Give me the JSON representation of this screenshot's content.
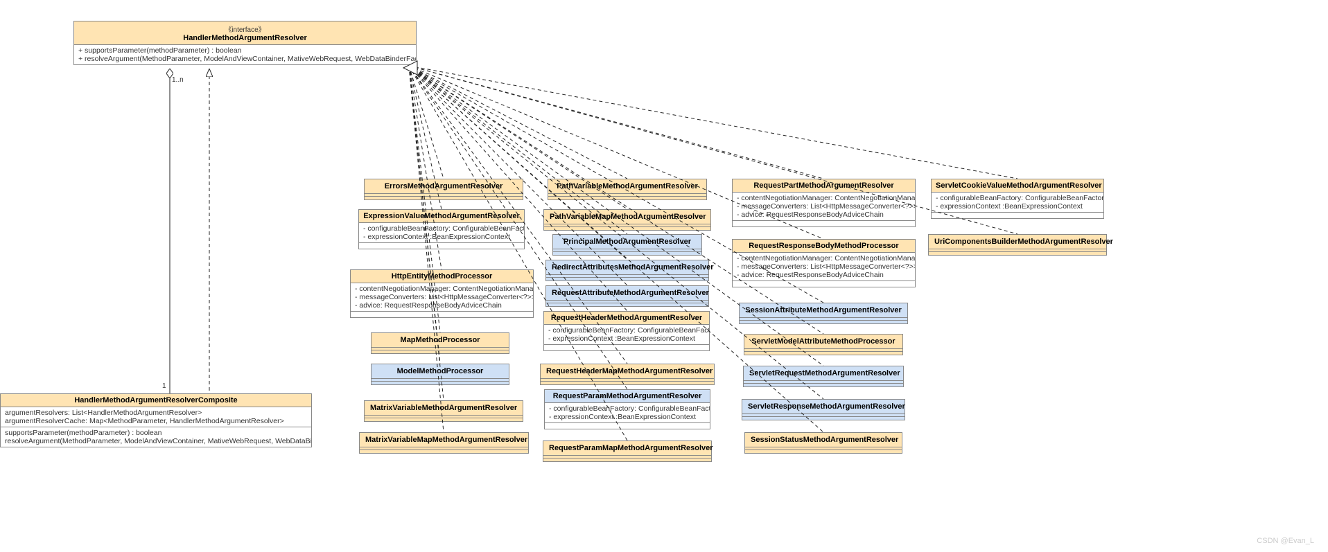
{
  "interface": {
    "stereotype": "《interface》",
    "name": "HandlerMethodArgumentResolver",
    "op1": "+ supportsParameter(methodParameter) : boolean",
    "op2": "+ resolveArgument(MethodParameter, ModelAndViewContainer, MativeWebRequest, WebDataBinderFactory): Object"
  },
  "composite": {
    "name": "HandlerMethodArgumentResolverComposite",
    "attr1": "argumentResolvers: List<HandlerMethodArgumentResolver>",
    "attr2": "argumentResolverCache: Map<MethodParameter, HandlerMethodArgumentResolver>",
    "op1": "supportsParameter(methodParameter) : boolean",
    "op2": "resolveArgument(MethodParameter, ModelAndViewContainer, MativeWebRequest, WebDataBinderFactory): Object"
  },
  "cardinality": {
    "top": "1..n",
    "bottom": "1"
  },
  "col1": {
    "errors": "ErrorsMethodArgumentResolver",
    "expr": {
      "name": "ExpressionValueMethodArgumentResolver",
      "a1": "- configurableBeanFactory: ConfigurableBeanFactory",
      "a2": "- expressionContext :BeanExpressionContext"
    },
    "httpentity": {
      "name": "HttpEntityMethodProcessor",
      "a1": "- contentNegotiationManager: ContentNegotiationManager",
      "a2": "- messageConverters: List<HttpMessageConverter<?>>",
      "a3": "- advice: RequestResponseBodyAdviceChain"
    },
    "map": "MapMethodProcessor",
    "model": "ModelMethodProcessor",
    "matrixvar": "MatrixVariableMethodArgumentResolver",
    "matrixvarmap": "MatrixVariableMapMethodArgumentResolver"
  },
  "col2": {
    "pathvar": "PathVariableMethodArgumentResolver",
    "pathvarmap": "PathVariableMapMethodArgumentResolver",
    "principal": "PrincipalMethodArgumentResolver",
    "redirect": "RedirectAttributesMethodArgumentResolver",
    "reqattr": "RequestAttributeMethodArgumentResolver",
    "reqheader": {
      "name": "RequestHeaderMethodArgumentResolver",
      "a1": "- configurableBeanFactory: ConfigurableBeanFactory",
      "a2": "- expressionContext :BeanExpressionContext"
    },
    "reqheadermap": "RequestHeaderMapMethodArgumentResolver",
    "reqparam": {
      "name": "RequestParamMethodArgumentResolver",
      "a1": "- configurableBeanFactory: ConfigurableBeanFactory",
      "a2": "- expressionContext :BeanExpressionContext"
    },
    "reqparammap": "RequestParamMapMethodArgumentResolver"
  },
  "col3": {
    "reqpart": {
      "name": "RequestPartMethodArgumentResolver",
      "a1": "- contentNegotiationManager: ContentNegotiationManager",
      "a2": "- messageConverters: List<HttpMessageConverter<?>>",
      "a3": "- advice: RequestResponseBodyAdviceChain"
    },
    "reqresp": {
      "name": "RequestResponseBodyMethodProcessor",
      "a1": "- contentNegotiationManager: ContentNegotiationManager",
      "a2": "- messageConverters: List<HttpMessageConverter<?>>",
      "a3": "- advice: RequestResponseBodyAdviceChain"
    },
    "sessattr": "SessionAttributeMethodArgumentResolver",
    "servletmodelattr": "ServletModelAttributeMethodProcessor",
    "servletreq": "ServletRequestMethodArgumentResolver",
    "servletresp": "ServletResponseMethodArgumentResolver",
    "sessstatus": "SessionStatusMethodArgumentResolver"
  },
  "col4": {
    "cookie": {
      "name": "ServletCookieValueMethodArgumentResolver",
      "a1": "- configurableBeanFactory: ConfigurableBeanFactory",
      "a2": "- expressionContext :BeanExpressionContext"
    },
    "uricomp": "UriComponentsBuilderMethodArgumentResolver"
  },
  "watermark": "CSDN @Evan_L"
}
